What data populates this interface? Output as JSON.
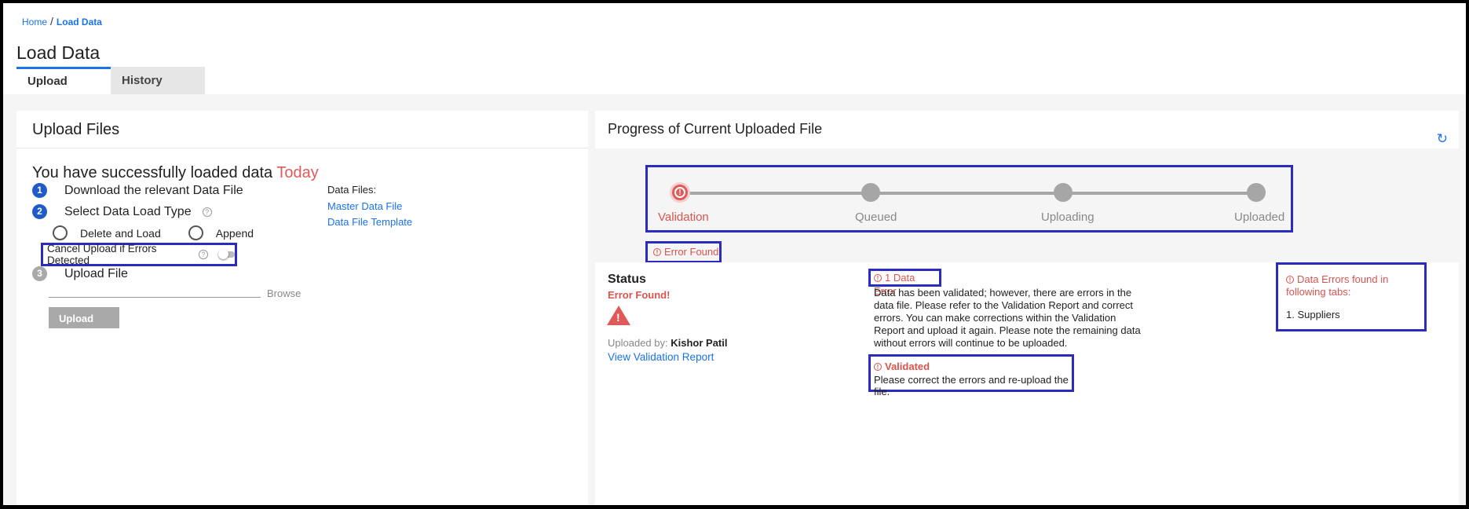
{
  "breadcrumb": {
    "home": "Home",
    "separator": "/",
    "current": "Load Data"
  },
  "page": {
    "title": "Load Data"
  },
  "tabs": [
    {
      "label": "Upload",
      "active": true
    },
    {
      "label": "History",
      "active": false
    }
  ],
  "upload_panel": {
    "title": "Upload Files",
    "success_message": "You have successfully loaded data",
    "success_highlight": "Today",
    "steps": [
      {
        "number": "1",
        "label": "Download the relevant Data File"
      },
      {
        "number": "2",
        "label": "Select Data Load Type"
      },
      {
        "number": "3",
        "label": "Upload File"
      }
    ],
    "help_glyph": "?",
    "load_types": [
      {
        "label": "Delete and Load"
      },
      {
        "label": "Append"
      }
    ],
    "cancel_option": {
      "label": "Cancel Upload if Errors Detected",
      "enabled": false
    },
    "file_input": {
      "value": "",
      "placeholder": ""
    },
    "browse_label": "Browse",
    "upload_button": "Upload",
    "data_files": {
      "label": "Data Files:",
      "links": [
        "Master Data File",
        "Data File Template"
      ]
    }
  },
  "progress_panel": {
    "title": "Progress of Current Uploaded File",
    "stages": [
      {
        "label": "Validation",
        "state": "error"
      },
      {
        "label": "Queued",
        "state": "pending"
      },
      {
        "label": "Uploading",
        "state": "pending"
      },
      {
        "label": "Uploaded",
        "state": "pending"
      }
    ],
    "error_badge": "Error Found",
    "error_glyph": "!",
    "status": {
      "title": "Status",
      "value": "Error Found!",
      "uploaded_by_label": "Uploaded by:",
      "uploaded_by_name": "Kishor Patil",
      "report_link": "View Validation Report"
    },
    "data_error": {
      "title": "1 Data Error",
      "message": "Data has been validated; however, there are errors in the data file. Please refer to the Validation Report and correct errors. You can make corrections within the Validation Report and upload it again. Please note the remaining data without errors will continue to be uploaded."
    },
    "validated": {
      "title": "Validated",
      "message": "Please correct the errors and re-upload the file."
    },
    "tab_errors": {
      "title": "Data Errors found in following tabs:",
      "items": [
        "1. Suppliers"
      ]
    }
  },
  "colors": {
    "accent": "#1a73e8",
    "error": "#d9534f",
    "step_blue": "#1e5bc6",
    "highlight_border": "#2b2bbf"
  },
  "icons": {
    "refresh": "refresh-icon",
    "warning": "warning-icon",
    "error": "error-circle-icon",
    "help": "help-icon"
  }
}
